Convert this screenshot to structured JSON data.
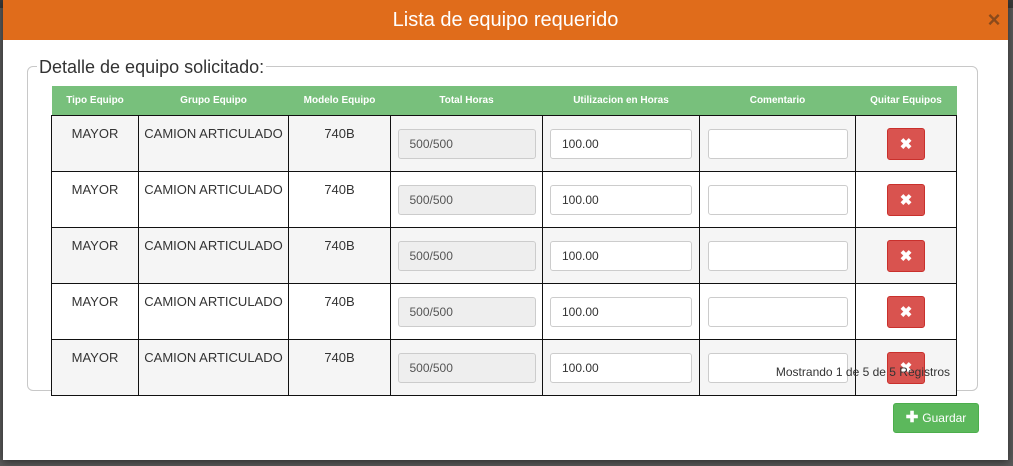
{
  "modal": {
    "title": "Lista de equipo requerido",
    "close_glyph": "×",
    "legend": "Detalle de equipo solicitado:"
  },
  "table": {
    "headers": [
      "Tipo Equipo",
      "Grupo Equipo",
      "Modelo Equipo",
      "Total Horas",
      "Utilizacion en Horas",
      "Comentario",
      "Quitar Equipos"
    ],
    "rows": [
      {
        "tipo": "MAYOR",
        "grupo": "CAMION ARTICULADO",
        "modelo": "740B",
        "total_horas": "500/500",
        "utilizacion": "100.00",
        "comentario": ""
      },
      {
        "tipo": "MAYOR",
        "grupo": "CAMION ARTICULADO",
        "modelo": "740B",
        "total_horas": "500/500",
        "utilizacion": "100.00",
        "comentario": ""
      },
      {
        "tipo": "MAYOR",
        "grupo": "CAMION ARTICULADO",
        "modelo": "740B",
        "total_horas": "500/500",
        "utilizacion": "100.00",
        "comentario": ""
      },
      {
        "tipo": "MAYOR",
        "grupo": "CAMION ARTICULADO",
        "modelo": "740B",
        "total_horas": "500/500",
        "utilizacion": "100.00",
        "comentario": ""
      },
      {
        "tipo": "MAYOR",
        "grupo": "CAMION ARTICULADO",
        "modelo": "740B",
        "total_horas": "500/500",
        "utilizacion": "100.00",
        "comentario": ""
      }
    ],
    "delete_glyph": "✖"
  },
  "footer": {
    "info": "Mostrando 1 de 5 de 5 Registros",
    "save_label": "Guardar",
    "save_glyph": "✚"
  },
  "colors": {
    "header_bg": "#e06c1b",
    "table_header_bg": "#78c07c",
    "delete_button": "#d9534f",
    "save_button": "#5cb85c"
  },
  "icons": [
    "close-icon",
    "remove-icon",
    "plus-icon"
  ]
}
